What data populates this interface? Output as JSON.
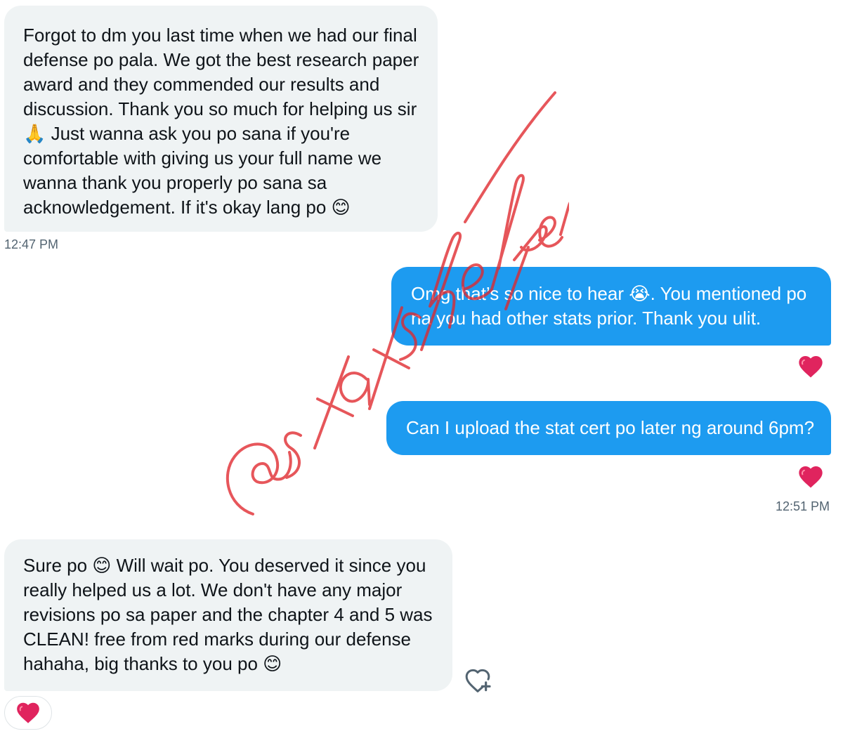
{
  "conversation": {
    "messages": [
      {
        "sender": "other",
        "lines": [
          "Forgot to dm you last time when we had our final",
          "defense po pala. We got the best research paper",
          "award and they commended our results and",
          "discussion. Thank you so much for helping us sir",
          "🙏 Just wanna ask you po sana if you're",
          "comfortable with giving us your full name we",
          "wanna thank you properly po sana sa",
          "acknowledgement. If it's okay lang po 😊"
        ],
        "timestamp": "12:47 PM"
      },
      {
        "sender": "me",
        "lines": [
          "Omg that’s so nice to hear 😭. You mentioned po",
          "na you had other stats prior. Thank you ulit."
        ],
        "reaction": "❤️"
      },
      {
        "sender": "me",
        "lines": [
          "Can I upload the stat cert po later ng around 6pm?"
        ],
        "reaction": "❤️",
        "timestamp": "12:51 PM"
      },
      {
        "sender": "other",
        "lines": [
          "Sure po 😊 Will wait po. You deserved it since you",
          "really helped us a lot. We don't have any major",
          "revisions po sa paper and the chapter 4 and 5 was",
          "CLEAN! free from red marks during our defense",
          "hahaha, big thanks to you po 😊"
        ],
        "reaction": "❤️"
      }
    ]
  },
  "watermark": {
    "text": "@statshelper_",
    "color": "#e0272d"
  },
  "colors": {
    "incoming_bubble": "#eff3f4",
    "outgoing_bubble": "#1d9bf0",
    "timestamp": "#536471",
    "heart": "#e0245e"
  },
  "icons": {
    "heart": "heart-icon",
    "add_reaction": "heart-plus-icon"
  }
}
